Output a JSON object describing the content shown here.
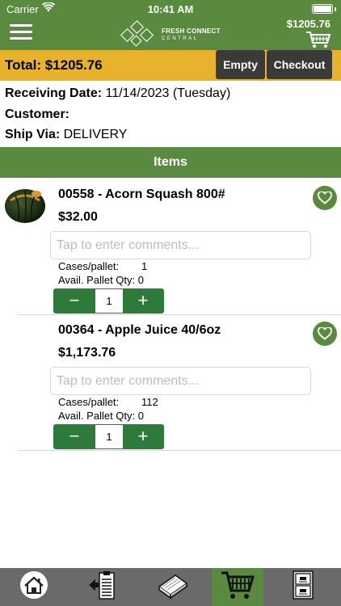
{
  "status_bar": {
    "carrier": "Carrier",
    "time": "10:41 AM"
  },
  "header": {
    "logo_line1": "FRESH CONNECT",
    "logo_line2": "CENTRAL",
    "cart_total": "$1205.76"
  },
  "total_bar": {
    "total_label": "Total:  $1205.76",
    "empty_label": "Empty",
    "checkout_label": "Checkout"
  },
  "order_info": {
    "receiving_label": "Receiving Date:",
    "receiving_value": "11/14/2023 (Tuesday)",
    "customer_label": "Customer:",
    "customer_value": "",
    "ship_label": "Ship Via:",
    "ship_value": "DELIVERY"
  },
  "items_header": "Items",
  "items": [
    {
      "title": "00558 - Acorn Squash 800#",
      "price": "$32.00",
      "comment_placeholder": "Tap to enter comments...",
      "cases_label": "Cases/pallet:",
      "cases_value": "1",
      "avail_label": "Avail. Pallet Qty: 0",
      "qty": "1",
      "minus": "−",
      "plus": "+"
    },
    {
      "title": "00364 - Apple Juice 40/6oz",
      "price": "$1,173.76",
      "comment_placeholder": "Tap to enter comments...",
      "cases_label": "Cases/pallet:",
      "cases_value": "112",
      "avail_label": "Avail. Pallet Qty: 0",
      "qty": "1",
      "minus": "−",
      "plus": "+"
    }
  ],
  "tabs": [
    {
      "icon": "home-icon",
      "active": false
    },
    {
      "icon": "clipboard-icon",
      "active": false
    },
    {
      "icon": "book-icon",
      "active": false
    },
    {
      "icon": "cart-icon",
      "active": true
    },
    {
      "icon": "file-cabinet-icon",
      "active": false
    }
  ],
  "colors": {
    "brand_green": "#5a8a3f",
    "accent_yellow": "#e8b22c",
    "button_dark": "#3a3a3a",
    "stepper_green": "#2e7a3a"
  }
}
